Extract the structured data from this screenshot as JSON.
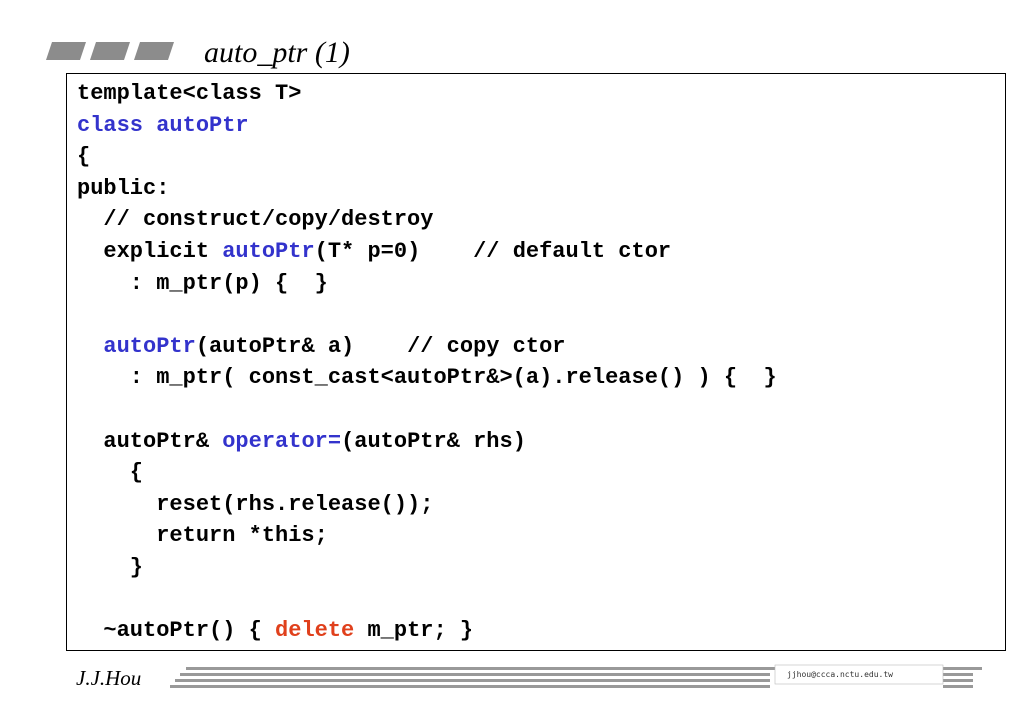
{
  "slide": {
    "title": "auto_ptr  (1)",
    "author": "J.J.Hou",
    "email": "jjhou@ccca.nctu.edu.tw"
  },
  "code_lines": [
    [
      {
        "t": "template<class T>",
        "c": "plain"
      }
    ],
    [
      {
        "t": "class autoPtr",
        "c": "kw"
      }
    ],
    [
      {
        "t": "{",
        "c": "plain"
      }
    ],
    [
      {
        "t": "public:",
        "c": "plain"
      }
    ],
    [
      {
        "t": "  // construct/copy/destroy",
        "c": "plain"
      }
    ],
    [
      {
        "t": "  explicit ",
        "c": "plain"
      },
      {
        "t": "autoPtr",
        "c": "kw"
      },
      {
        "t": "(T* p=0)    // default ctor",
        "c": "plain"
      }
    ],
    [
      {
        "t": "    : m_ptr(p) {  }",
        "c": "plain"
      }
    ],
    [
      {
        "t": "",
        "c": "plain"
      }
    ],
    [
      {
        "t": "  ",
        "c": "plain"
      },
      {
        "t": "autoPtr",
        "c": "kw"
      },
      {
        "t": "(autoPtr& a)    // copy ctor",
        "c": "plain"
      }
    ],
    [
      {
        "t": "    : m_ptr( const_cast<autoPtr&>(a).release() ) {  }",
        "c": "plain"
      }
    ],
    [
      {
        "t": "",
        "c": "plain"
      }
    ],
    [
      {
        "t": "  autoPtr& ",
        "c": "plain"
      },
      {
        "t": "operator=",
        "c": "kw"
      },
      {
        "t": "(autoPtr& rhs)",
        "c": "plain"
      }
    ],
    [
      {
        "t": "    {",
        "c": "plain"
      }
    ],
    [
      {
        "t": "      reset(rhs.release());",
        "c": "plain"
      }
    ],
    [
      {
        "t": "      return *this;",
        "c": "plain"
      }
    ],
    [
      {
        "t": "    }",
        "c": "plain"
      }
    ],
    [
      {
        "t": "",
        "c": "plain"
      }
    ],
    [
      {
        "t": "  ~autoPtr() { ",
        "c": "plain"
      },
      {
        "t": "delete",
        "c": "del"
      },
      {
        "t": " m_ptr; }",
        "c": "plain"
      }
    ]
  ]
}
